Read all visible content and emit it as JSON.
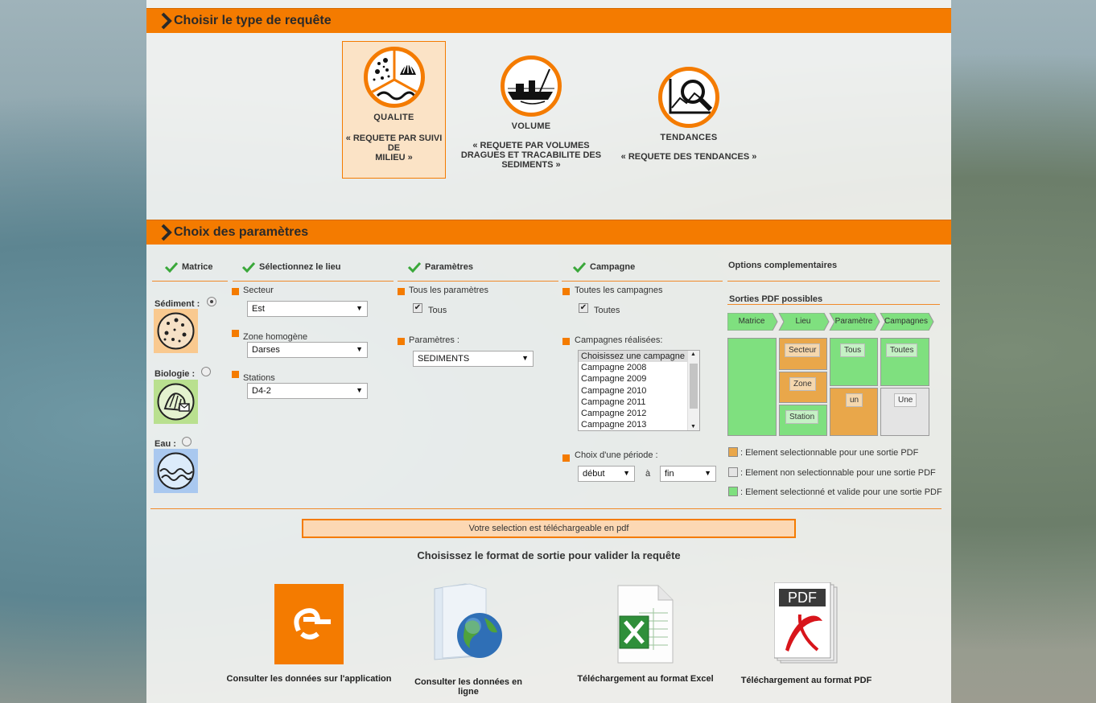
{
  "section1": {
    "title": "Choisir le type de requête"
  },
  "query_types": [
    {
      "name": "QUALITE",
      "desc1": "« REQUETE PAR SUIVI",
      "desc2": "DE",
      "desc3": "MILIEU »"
    },
    {
      "name": "VOLUME",
      "desc1": "« REQUETE PAR VOLUMES",
      "desc2": "DRAGUES ET TRACABILITE DES",
      "desc3": "SEDIMENTS »"
    },
    {
      "name": "TENDANCES",
      "desc1": "« REQUETE DES TENDANCES »"
    }
  ],
  "section2": {
    "title": "Choix des paramètres"
  },
  "columns": {
    "matrice": "Matrice",
    "lieu": "Sélectionnez le lieu",
    "parametres": "Paramètres",
    "campagne": "Campagne",
    "options": "Options complementaires"
  },
  "matrice": {
    "sediment": "Sédiment :",
    "biologie": "Biologie :",
    "eau": "Eau :"
  },
  "lieu": {
    "secteur_label": "Secteur",
    "secteur_value": "Est",
    "zone_label": "Zone homogène",
    "zone_value": "Darses",
    "stations_label": "Stations",
    "stations_value": "D4-2"
  },
  "parametres": {
    "all_label": "Tous les paramètres",
    "all_check": "Tous",
    "param_label": "Paramètres :",
    "param_value": "SEDIMENTS"
  },
  "campagne": {
    "all_label": "Toutes les campagnes",
    "all_check": "Toutes",
    "realised_label": "Campagnes réalisées:",
    "options": [
      "Choisissez une campagne",
      "Campagne 2008",
      "Campagne 2009",
      "Campagne 2010",
      "Campagne 2011",
      "Campagne 2012",
      "Campagne 2013"
    ],
    "period_label": "Choix d'une période :",
    "start_value": "début",
    "a_label": "à",
    "end_value": "fin"
  },
  "options": {
    "pdf_title": "Sorties PDF possibles",
    "steps": [
      "Matrice",
      "Lieu",
      "Paramètre",
      "Campagnes"
    ],
    "secteur": "Secteur",
    "zone": "Zone",
    "station": "Station",
    "tous": "Tous",
    "un": "un",
    "toutes": "Toutes",
    "une": "Une",
    "legend1": ": Element selectionnable pour une sortie PDF",
    "legend2": ": Element non selectionnable pour une sortie PDF",
    "legend3": ": Element selectionné et valide pour une sortie PDF",
    "colors": {
      "selectable": "#e9a74a",
      "non_selectable": "#e4e4e4",
      "valid": "#7fe07f"
    }
  },
  "download_banner": "Votre selection est téléchargeable en pdf",
  "output_title": "Choisissez le format de sortie pour valider la requête",
  "outputs": [
    {
      "label": "Consulter les données sur l'application",
      "icon": "e-app-icon"
    },
    {
      "label": "Consulter les données en ligne",
      "icon": "globe-folder-icon"
    },
    {
      "label": "Téléchargement au format Excel",
      "icon": "excel-icon"
    },
    {
      "label": "Téléchargement au format PDF",
      "icon": "pdf-icon",
      "badge": "PDF"
    }
  ],
  "accent": "#f47b00"
}
